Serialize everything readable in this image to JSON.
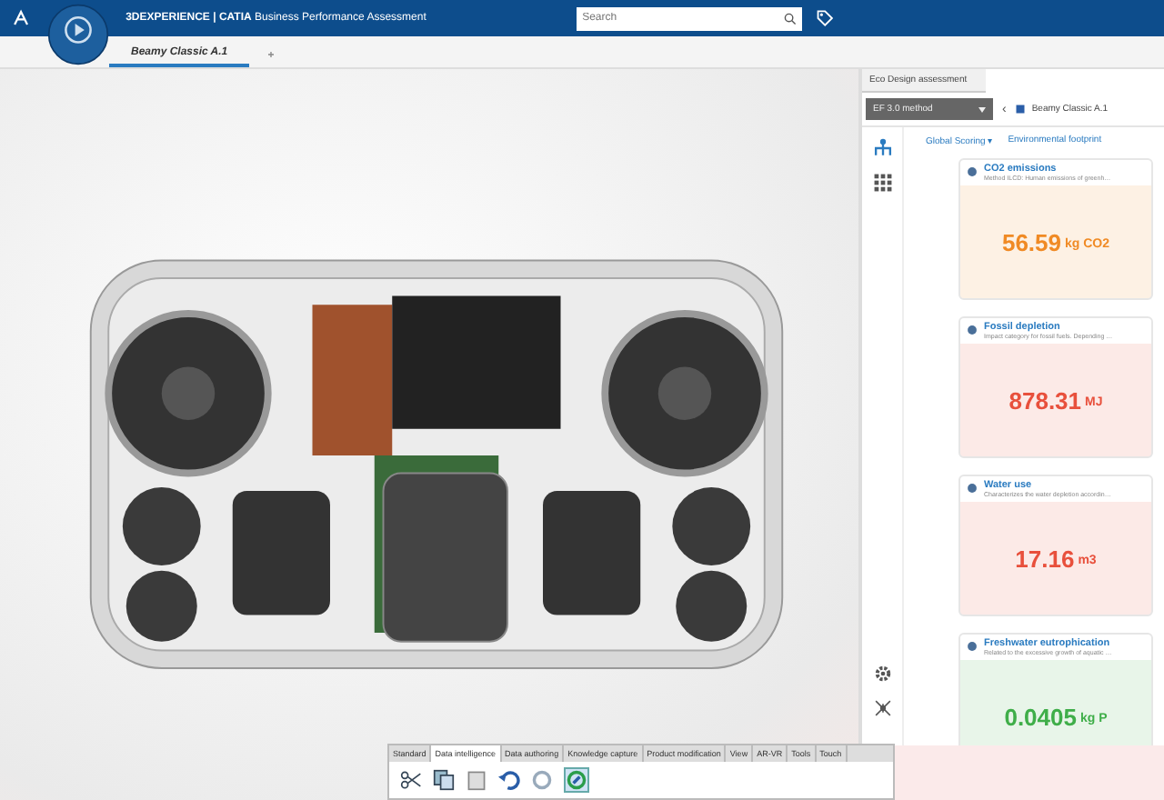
{
  "header": {
    "brand": "3DEXPERIENCE | CATIA",
    "app_title": "Business Performance Assessment",
    "search": {
      "placeholder": "Search"
    }
  },
  "tabs": [
    {
      "label": "Beamy Classic A.1",
      "selected": true
    },
    {
      "label": "+",
      "selected": false
    }
  ],
  "panel": {
    "title": "Eco Design assessment",
    "method": "EF 3.0 method",
    "nav_prev": "‹",
    "product": "Beamy Classic A.1",
    "scoring": "Global Scoring ▾",
    "footprint": "Environmental footprint",
    "cards": [
      {
        "title": "CO2 emissions",
        "subtitle": "Method ILCD: Human emissions of greenh…",
        "value": "56.59",
        "unit": "kg CO2",
        "color": "#f08a24"
      },
      {
        "title": "Fossil depletion",
        "subtitle": "Impact category for fossil fuels. Depending …",
        "value": "878.31",
        "unit": "MJ",
        "color": "#e8503c"
      },
      {
        "title": "Water use",
        "subtitle": "Characterizes the water depletion accordin…",
        "value": "17.16",
        "unit": "m3",
        "color": "#e8503c"
      },
      {
        "title": "Freshwater eutrophication",
        "subtitle": "Related to the excessive growth of aquatic …",
        "value": "0.0405",
        "unit": "kg P",
        "color": "#3fae49"
      }
    ]
  },
  "action_bar": {
    "tabs": [
      {
        "label": "Standard",
        "selected": false
      },
      {
        "label": "Data intelligence",
        "selected": true
      },
      {
        "label": "Data authoring",
        "selected": false
      },
      {
        "label": "Knowledge capture",
        "selected": false
      },
      {
        "label": "Product modification",
        "selected": false
      },
      {
        "label": "View",
        "selected": false
      },
      {
        "label": "AR-VR",
        "selected": false
      },
      {
        "label": "Tools",
        "selected": false
      },
      {
        "label": "Touch",
        "selected": false
      }
    ]
  }
}
